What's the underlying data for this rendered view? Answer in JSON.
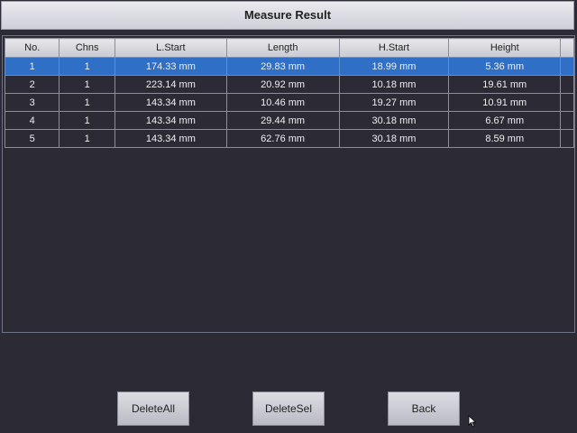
{
  "window": {
    "title": "Measure Result"
  },
  "table": {
    "headers": [
      "No.",
      "Chns",
      "L.Start",
      "Length",
      "H.Start",
      "Height"
    ],
    "rows": [
      [
        "1",
        "1",
        "174.33 mm",
        "29.83 mm",
        "18.99 mm",
        "5.36 mm"
      ],
      [
        "2",
        "1",
        "223.14 mm",
        "20.92 mm",
        "10.18 mm",
        "19.61 mm"
      ],
      [
        "3",
        "1",
        "143.34 mm",
        "10.46 mm",
        "19.27 mm",
        "10.91 mm"
      ],
      [
        "4",
        "1",
        "143.34 mm",
        "29.44 mm",
        "30.18 mm",
        "6.67 mm"
      ],
      [
        "5",
        "1",
        "143.34 mm",
        "62.76 mm",
        "30.18 mm",
        "8.59 mm"
      ]
    ],
    "selected_row": "1"
  },
  "buttons": {
    "delete_all": "DeleteAll",
    "delete_sel": "DeleteSel",
    "back": "Back"
  },
  "icons": {
    "cursor": "mouse-pointer-icon"
  },
  "colors": {
    "background": "#2b2a35",
    "selection": "#2f6fc6",
    "header": "#d8d9df"
  }
}
